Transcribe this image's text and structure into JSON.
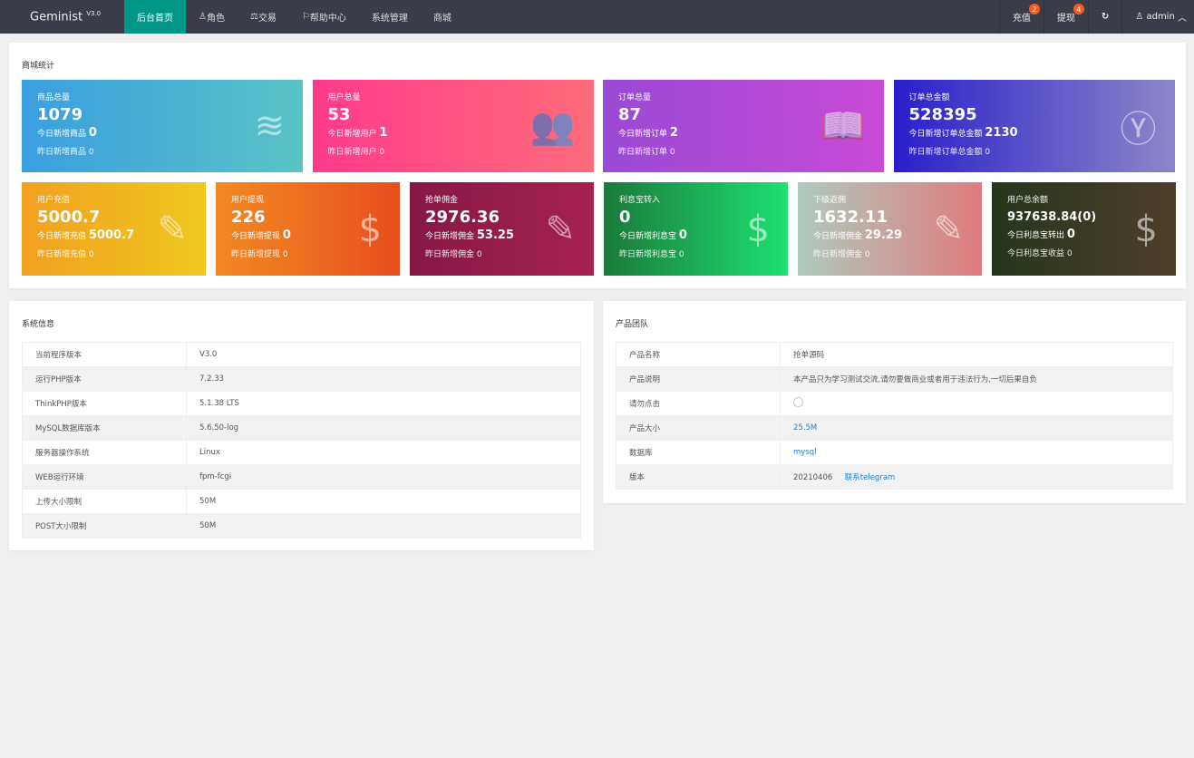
{
  "header": {
    "brand": "Geminist",
    "version": "V3.0",
    "nav": [
      {
        "label": "后台首页",
        "icon": ""
      },
      {
        "label": "角色",
        "icon": "user-icon"
      },
      {
        "label": "交易",
        "icon": "scale-icon"
      },
      {
        "label": "帮助中心",
        "icon": "flag-icon"
      },
      {
        "label": "系统管理",
        "icon": ""
      },
      {
        "label": "商城",
        "icon": ""
      }
    ],
    "recharge": "充值",
    "recharge_badge": "2",
    "withdraw": "提现",
    "withdraw_badge": "4",
    "refresh_icon": "refresh-icon",
    "user": "admin"
  },
  "stats": {
    "title": "商城统计",
    "cards": [
      {
        "title": "商品总量",
        "value": "1079",
        "today_label": "今日新增商品",
        "today": "0",
        "yesterday_label": "昨日新增商品",
        "yesterday": "0",
        "icon": "layers-icon",
        "colors": [
          "#3a9fe0",
          "#5ac3c6"
        ]
      },
      {
        "title": "用户总量",
        "value": "53",
        "today_label": "今日新增用户",
        "today": "1",
        "yesterday_label": "昨日新增用户",
        "yesterday": "0",
        "icon": "users-icon",
        "colors": [
          "#ff3a8c",
          "#ff6c7a"
        ]
      },
      {
        "title": "订单总量",
        "value": "87",
        "today_label": "今日新增订单",
        "today": "2",
        "yesterday_label": "昨日新增订单",
        "yesterday": "0",
        "icon": "book-icon",
        "colors": [
          "#9a4ad6",
          "#c84bd6"
        ]
      },
      {
        "title": "订单总金额",
        "value": "528395",
        "today_label": "今日新增订单总金额",
        "today": "2130",
        "yesterday_label": "昨日新增订单总金额",
        "yesterday": "0",
        "icon": "yen-icon",
        "colors": [
          "#2a1fca",
          "#8c86c8"
        ]
      },
      {
        "title": "用户充值",
        "value": "5000.7",
        "today_label": "今日新增充值",
        "today": "5000.7",
        "yesterday_label": "昨日新增充值",
        "yesterday": "0",
        "icon": "edit-question-icon",
        "colors": [
          "#f0a020",
          "#f0c820"
        ]
      },
      {
        "title": "用户提现",
        "value": "226",
        "today_label": "今日新增提现",
        "today": "0",
        "yesterday_label": "昨日新增提现",
        "yesterday": "0",
        "icon": "dollar-icon",
        "colors": [
          "#f28a22",
          "#e84e1e"
        ]
      },
      {
        "title": "抢单佣金",
        "value": "2976.36",
        "today_label": "今日新增佣金",
        "today": "53.25",
        "yesterday_label": "昨日新增佣金",
        "yesterday": "0",
        "icon": "edit-question-icon",
        "colors": [
          "#861846",
          "#a52150"
        ]
      },
      {
        "title": "利息宝转入",
        "value": "0",
        "today_label": "今日新增利息宝",
        "today": "0",
        "yesterday_label": "昨日新增利息宝",
        "yesterday": "0",
        "icon": "dollar-icon",
        "colors": [
          "#1a7a3a",
          "#1ee070"
        ]
      },
      {
        "title": "下级返佣",
        "value": "1632.11",
        "today_label": "今日新增佣金",
        "today": "29.29",
        "yesterday_label": "昨日新增佣金",
        "yesterday": "0",
        "icon": "edit-question-icon",
        "colors": [
          "#aecbbe",
          "#e07a7e"
        ]
      },
      {
        "title": "用户总余额",
        "value": "937638.84(0)",
        "today_label": "今日利息宝转出",
        "today": "0",
        "yesterday_label": "今日利息宝收益",
        "yesterday": "0",
        "icon": "dollar-icon",
        "colors": [
          "#26361e",
          "#4e3e2c"
        ]
      }
    ]
  },
  "system": {
    "title": "系统信息",
    "rows": [
      [
        "当前程序版本",
        "V3.0"
      ],
      [
        "运行PHP版本",
        "7.2.33"
      ],
      [
        "ThinkPHP版本",
        "5.1.38 LTS"
      ],
      [
        "MySQL数据库版本",
        "5.6.50-log"
      ],
      [
        "服务器操作系统",
        "Linux"
      ],
      [
        "WEB运行环境",
        "fpm-fcgi"
      ],
      [
        "上传大小限制",
        "50M"
      ],
      [
        "POST大小限制",
        "50M"
      ]
    ]
  },
  "team": {
    "title": "产品团队",
    "rows": [
      [
        "产品名称",
        "抢单源码"
      ],
      [
        "产品说明",
        "本产品只为学习测试交流,请勿要做商业或者用于违法行为,一切后果自负"
      ],
      [
        "请勿点击",
        ""
      ],
      [
        "产品大小",
        "25.5M"
      ],
      [
        "数据库",
        "mysql"
      ],
      [
        "版本",
        "20210406"
      ]
    ],
    "contact": "联系telegram"
  }
}
